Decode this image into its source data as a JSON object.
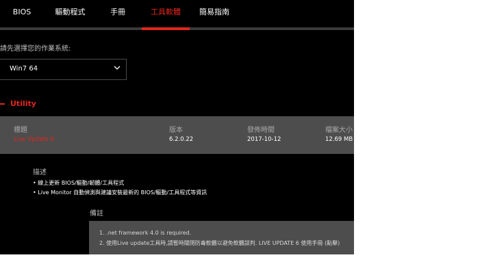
{
  "tabs": [
    "BIOS",
    "驅動程式",
    "手冊",
    "工具軟體",
    "簡易指南"
  ],
  "active_tab": "工具軟體",
  "os": {
    "label": "請先選擇您的作業系統:",
    "selected": "Win7 64"
  },
  "category": "Utility",
  "table": {
    "headers": [
      "標題",
      "版本",
      "發佈時間",
      "檔案大小"
    ],
    "row": {
      "title": "Live Update 6",
      "version": "6.2.0.22",
      "date": "2017-10-12",
      "size": "12.69 MB"
    }
  },
  "description": {
    "title": "描述",
    "items": [
      "• 線上更新 BIOS/驅動/韌體/工具程式",
      "• Live Monitor 自動偵測與建議安裝最新的 BIOS/驅動/工具程式等資訊"
    ]
  },
  "remarks": {
    "title": "備註",
    "items": [
      "1. .net framework 4.0 is required.",
      "2. 使用Live update工具時,請暫時關閉防毒軟體以避免軟體誤判. LIVE UPDATE 6 使用手冊 (點擊)"
    ]
  },
  "colors": {
    "accent": "#e1261c",
    "background": "#000000",
    "table_bg": "#4d4d4d"
  }
}
